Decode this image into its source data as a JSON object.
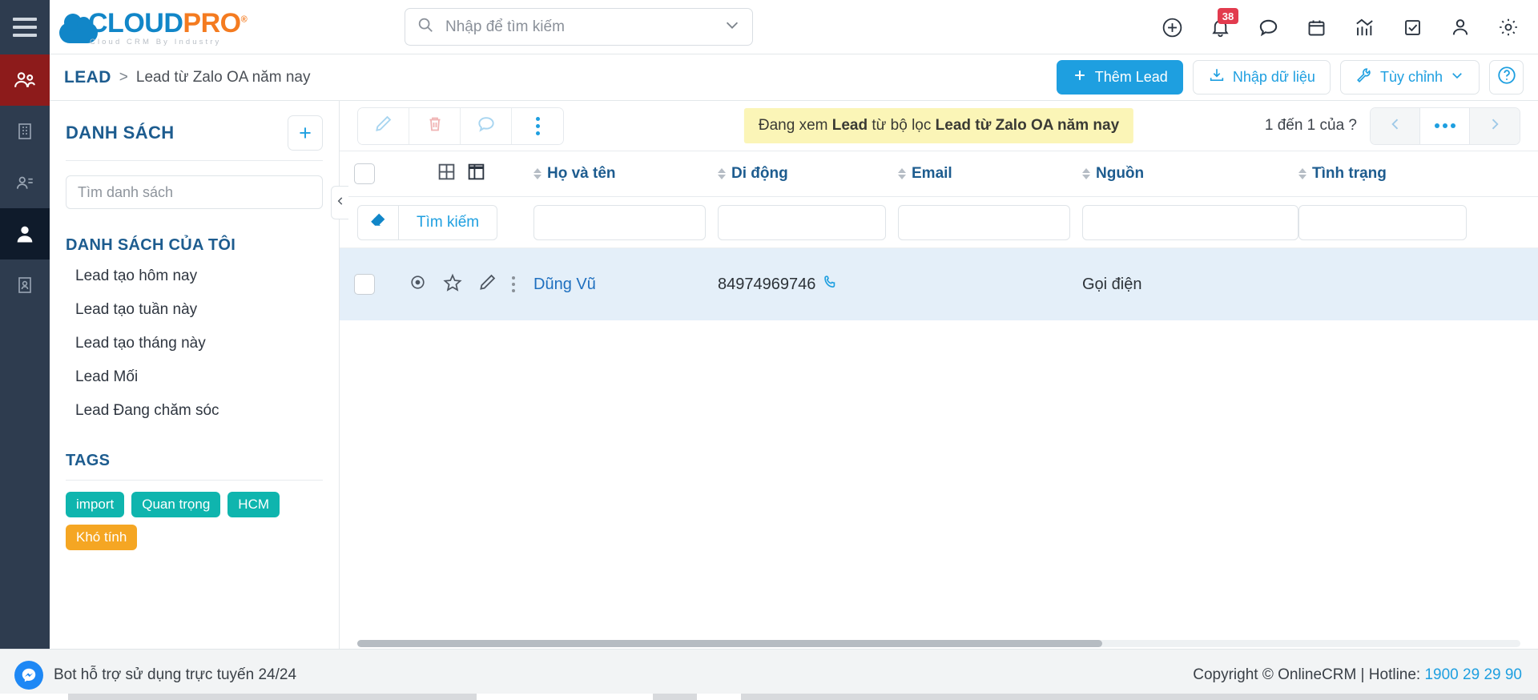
{
  "brand": {
    "name_part1": "CLOUD",
    "name_part2": "PRO",
    "registered": "®",
    "tagline": "Cloud CRM By Industry",
    "accent_blue": "#1186c8",
    "accent_orange": "#f47b20"
  },
  "topbar": {
    "menu_icon": "hamburger-icon",
    "search": {
      "placeholder": "Nhập để tìm kiếm",
      "value": "",
      "icon": "search-icon",
      "dropdown_icon": "chevron-down-icon"
    },
    "icons": [
      {
        "name": "add-circle-icon",
        "label": "add-new"
      },
      {
        "name": "bell-icon",
        "label": "notifications",
        "badge": "38"
      },
      {
        "name": "chat-bubble-icon",
        "label": "messages"
      },
      {
        "name": "calendar-icon",
        "label": "calendar"
      },
      {
        "name": "chart-icon",
        "label": "reports"
      },
      {
        "name": "checkbox-icon",
        "label": "tasks"
      },
      {
        "name": "user-icon",
        "label": "profile"
      },
      {
        "name": "gear-icon",
        "label": "settings"
      }
    ],
    "badge_color": "#e23b4e"
  },
  "subbar": {
    "breadcrumb": {
      "root": "LEAD",
      "separator": ">",
      "leaf": "Lead từ Zalo OA năm nay"
    },
    "buttons": {
      "add_lead": "Thêm Lead",
      "import_data": "Nhập dữ liệu",
      "customize": "Tùy chỉnh",
      "help": "?"
    }
  },
  "sidebar_rail": {
    "items": [
      {
        "name": "sidebar-rail-users",
        "icon": "users-group-icon",
        "state": "accent"
      },
      {
        "name": "sidebar-rail-company",
        "icon": "building-icon",
        "state": "normal"
      },
      {
        "name": "sidebar-rail-contacts",
        "icon": "person-lines-icon",
        "state": "normal"
      },
      {
        "name": "sidebar-rail-lead",
        "icon": "person-icon",
        "state": "active"
      },
      {
        "name": "sidebar-rail-report",
        "icon": "document-person-icon",
        "state": "normal"
      }
    ]
  },
  "listpanel": {
    "title": "DANH SÁCH",
    "add_button": "+",
    "search_placeholder": "Tìm danh sách",
    "search_value": "",
    "my_lists_title": "DANH SÁCH CỦA TÔI",
    "items": [
      {
        "label": "Lead tạo hôm nay"
      },
      {
        "label": "Lead tạo tuần này"
      },
      {
        "label": "Lead tạo tháng này"
      },
      {
        "label": "Lead Mối"
      },
      {
        "label": "Lead Đang chăm sóc"
      }
    ],
    "tags_title": "TAGS",
    "tags": [
      {
        "label": "import",
        "color": "#0fb5ae"
      },
      {
        "label": "Quan trọng",
        "color": "#0fb5ae"
      },
      {
        "label": "HCM",
        "color": "#0fb5ae"
      },
      {
        "label": "Khó tính",
        "color": "#f5a623"
      }
    ]
  },
  "grid": {
    "toolbar_icons": [
      {
        "name": "edit-pencil-icon",
        "color": "#a8d5f0"
      },
      {
        "name": "trash-icon",
        "color": "#f0b4b4"
      },
      {
        "name": "comment-icon",
        "color": "#a8d5f0"
      },
      {
        "name": "more-vertical-icon",
        "color": "#1e9fe0"
      }
    ],
    "filter_banner": {
      "prefix": "Đang xem ",
      "bold1": "Lead",
      "middle": " từ bộ lọc ",
      "bold2": "Lead từ Zalo OA năm nay",
      "background": "#fbf5b7"
    },
    "pagination": {
      "text": "1 đến 1 của ?",
      "prev_icon": "chevron-left-icon",
      "more_icon": "ellipsis-icon",
      "next_icon": "chevron-right-icon"
    },
    "view_icons": [
      {
        "name": "grid-view-icon"
      },
      {
        "name": "split-view-icon"
      }
    ],
    "columns": [
      {
        "key": "name",
        "label": "Họ và tên",
        "sortable": true
      },
      {
        "key": "mobile",
        "label": "Di động",
        "sortable": true
      },
      {
        "key": "email",
        "label": "Email",
        "sortable": true
      },
      {
        "key": "source",
        "label": "Nguồn",
        "sortable": true
      },
      {
        "key": "status",
        "label": "Tình trạng",
        "sortable": true
      }
    ],
    "filter_row": {
      "erase_icon": "eraser-icon",
      "search_label": "Tìm kiếm",
      "inputs": [
        "",
        "",
        "",
        "",
        ""
      ]
    },
    "rows": [
      {
        "row_icons": [
          {
            "name": "eye-view-icon"
          },
          {
            "name": "star-icon"
          },
          {
            "name": "edit-pencil-icon"
          },
          {
            "name": "more-vertical-icon"
          }
        ],
        "name": "Dũng Vũ",
        "mobile": "84974969746",
        "mobile_icon": "phone-call-icon",
        "email": "",
        "source": "Gọi điện",
        "status": "",
        "selected_background": "#e4eff9"
      }
    ]
  },
  "footer": {
    "bot_icon": "messenger-icon",
    "bot_text": "Bot hỗ trợ sử dụng trực tuyến 24/24",
    "copyright": "Copyright © OnlineCRM | Hotline: ",
    "hotline": "1900 29 29 90"
  }
}
